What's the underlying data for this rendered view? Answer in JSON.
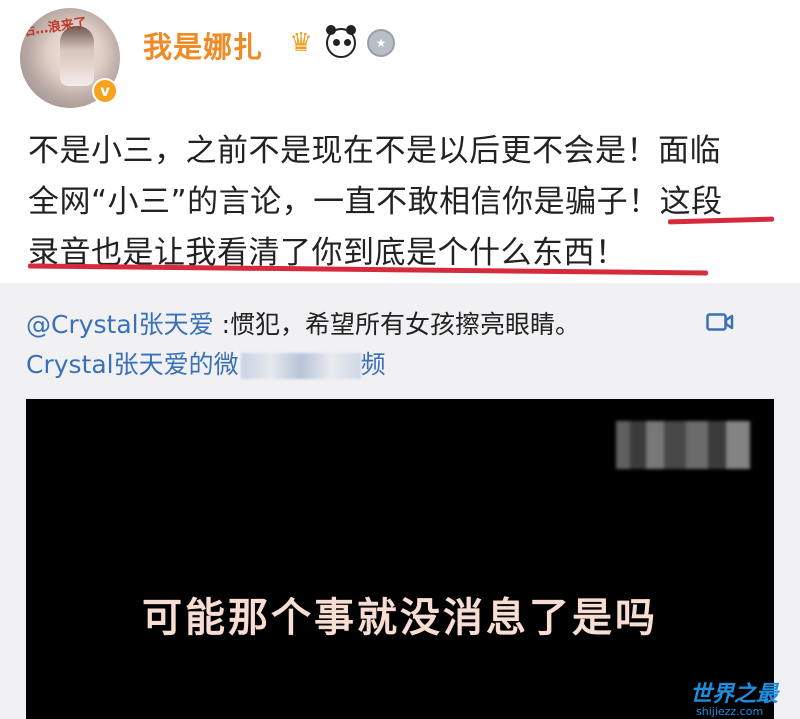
{
  "post": {
    "username": "我是娜扎",
    "avatar_sticker": "后…浪来了",
    "verified_mark": "v",
    "badges": [
      "crown-icon",
      "panda-icon",
      "medal-icon"
    ],
    "text_line1": "不是小三，之前不是现在不是以后更不会是！面临",
    "text_line2_a": "全网“小三”的言论，一直不敢相信你是骗子！",
    "text_line2_b": "这段",
    "text_line3": "录音也是让我看清了你到底是个什么东西！",
    "underline_color": "#d62a3d"
  },
  "repost": {
    "mention": "@Crystal张天爱",
    "text": " :惯犯，希望所有女孩擦亮眼睛。",
    "video_link_prefix": "Crystal张天爱的微",
    "video_link_suffix": "频",
    "video_subtitle": "可能那个事就没消息了是吗"
  },
  "watermark": {
    "title": "世界之最",
    "url": "shijiezz.com"
  },
  "colors": {
    "username": "#f08a24",
    "link": "#3a70b7",
    "repost_bg": "#f1f1f3"
  }
}
